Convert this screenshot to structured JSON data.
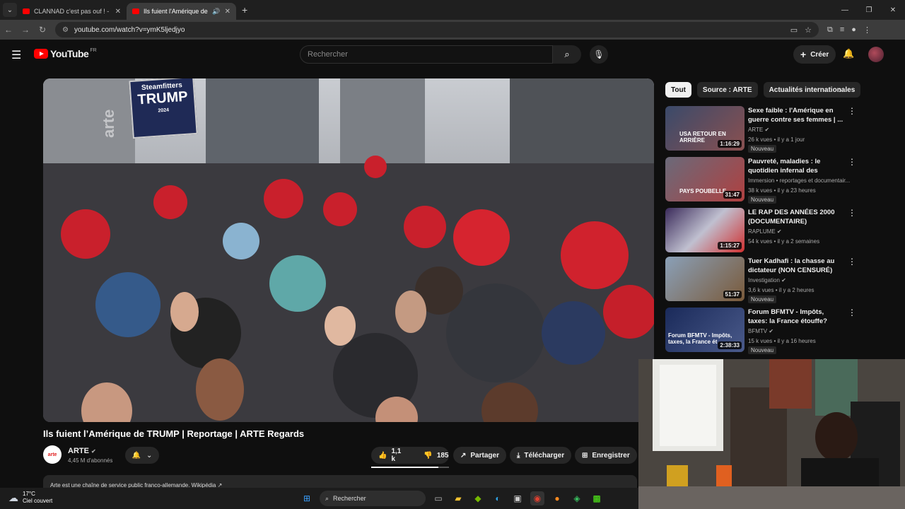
{
  "browser": {
    "tabs": [
      {
        "title": "CLANNAD c'est pas ouf ! - YouT"
      },
      {
        "title": "Ils fuient l'Amérique de TRU"
      }
    ],
    "url": "youtube.com/watch?v=ymK5ljedjyo"
  },
  "header": {
    "logo": "YouTube",
    "country": "FR",
    "search_placeholder": "Rechercher",
    "create_label": "Créer"
  },
  "video": {
    "watermark": "arte",
    "sign_line1": "Steamfitters",
    "sign_line2": "TRUMP",
    "sign_line3": "2024",
    "title": "Ils fuient l’Amérique de TRUMP | Reportage | ARTE Regards",
    "channel": "ARTE",
    "channel_avatar_text": "arte",
    "subscribers": "4,45 M d'abonnés",
    "likes": "1,1 k",
    "dislikes": "185",
    "like_ratio": 0.86,
    "share_label": "Partager",
    "download_label": "Télécharger",
    "save_label": "Enregistrer",
    "description_preview": "Arte est une chaîne de service public franco-allemande. Wikipédia ↗"
  },
  "sidebar": {
    "chips": [
      "Tout",
      "Source : ARTE",
      "Actualités internationales"
    ],
    "recommendations": [
      {
        "title": "Sexe faible : l'Amérique en guerre contre ses femmes | ...",
        "channel": "ARTE",
        "meta": "26 k vues • il y a 1 jour",
        "duration": "1:16:29",
        "badge": "Nouveau",
        "thumb_text": "USA RETOUR EN ARRIÈRE",
        "verified": true
      },
      {
        "title": "Pauvreté, maladies : le quotidien infernal des habitant...",
        "channel": "Immersion • reportages et documentair...",
        "meta": "38 k vues • il y a 23 heures",
        "duration": "31:47",
        "badge": "Nouveau",
        "thumb_text": "PAYS POUBELLE",
        "verified": false
      },
      {
        "title": "LE RAP DES ANNÉES 2000 (DOCUMENTAIRE)",
        "channel": "RAPLUME",
        "meta": "54 k vues • il y a 2 semaines",
        "duration": "1:15:27",
        "badge": "",
        "thumb_text": "",
        "verified": true
      },
      {
        "title": "Tuer Kadhafi : la chasse au dictateur (NON CENSURÉ)",
        "channel": "Investigation",
        "meta": "3,6 k vues • il y a 2 heures",
        "duration": "51:37",
        "badge": "Nouveau",
        "thumb_text": "",
        "verified": true
      },
      {
        "title": "Forum BFMTV - Impôts, taxes: la France étouffe?",
        "channel": "BFMTV",
        "meta": "15 k vues • il y a 16 heures",
        "duration": "2:38:33",
        "badge": "Nouveau",
        "thumb_text": "Forum BFMTV - Impôts, taxes, la France ét",
        "verified": true
      }
    ]
  },
  "taskbar": {
    "temperature": "17°C",
    "weather_desc": "Ciel couvert",
    "search_label": "Rechercher"
  }
}
